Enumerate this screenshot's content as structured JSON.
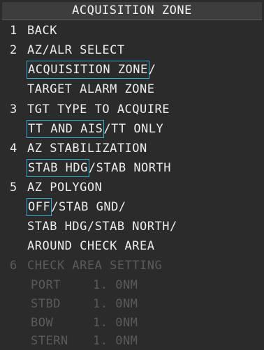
{
  "title": "ACQUISITION ZONE",
  "menu": [
    {
      "num": "1",
      "label": "BACK"
    },
    {
      "num": "2",
      "label": "AZ/ALR SELECT",
      "options": [
        [
          "ACQUISITION ZONE",
          "/"
        ],
        [
          "TARGET ALARM ZONE"
        ]
      ],
      "selected": "ACQUISITION ZONE"
    },
    {
      "num": "3",
      "label": "TGT TYPE TO ACQUIRE",
      "options": [
        [
          "TT AND AIS",
          "/",
          "TT ONLY"
        ]
      ],
      "selected": "TT AND AIS"
    },
    {
      "num": "4",
      "label": "AZ STABILIZATION",
      "options": [
        [
          "STAB HDG",
          "/",
          "STAB NORTH"
        ]
      ],
      "selected": "STAB HDG"
    },
    {
      "num": "5",
      "label": "AZ POLYGON",
      "options": [
        [
          "OFF",
          "/",
          "STAB GND/"
        ],
        [
          "STAB HDG/STAB NORTH/"
        ],
        [
          "AROUND CHECK AREA"
        ]
      ],
      "selected": "OFF"
    },
    {
      "num": "6",
      "label": "CHECK AREA SETTING",
      "disabled": true,
      "settings": [
        {
          "name": "PORT",
          "value": "1. 0NM"
        },
        {
          "name": "STBD",
          "value": "1. 0NM"
        },
        {
          "name": "BOW",
          "value": "1. 0NM"
        },
        {
          "name": "STERN",
          "value": "1. 0NM"
        }
      ]
    }
  ],
  "colors": {
    "background": "#2b2b2b",
    "text": "#ededed",
    "disabled_text": "#5b5b5b",
    "selection_outline": "#27b4d6"
  }
}
